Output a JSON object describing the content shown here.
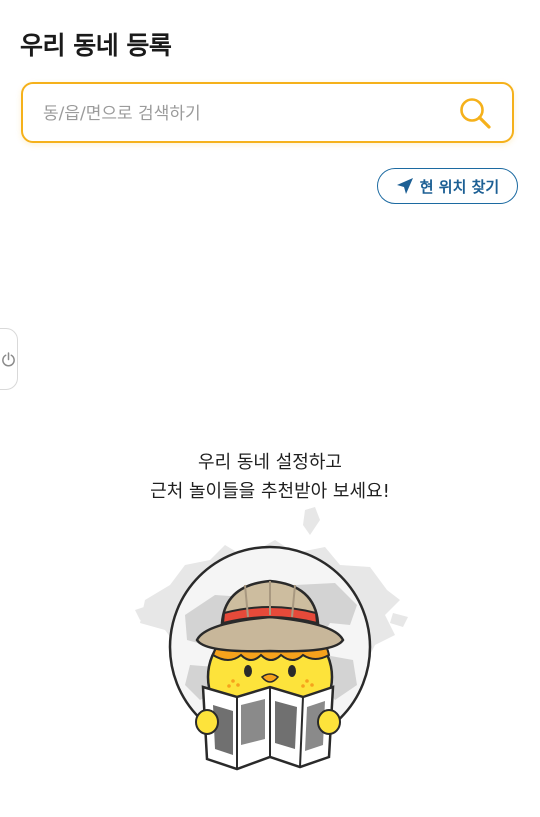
{
  "page": {
    "title": "우리 동네 등록"
  },
  "search": {
    "placeholder": "동/읍/면으로 검색하기",
    "value": ""
  },
  "locate_button": {
    "label": "현 위치 찾기"
  },
  "empty_state": {
    "line1": "우리 동네 설정하고",
    "line2": "근처 놀이들을 추천받아 보세요!"
  },
  "colors": {
    "accent": "#f5b11b",
    "locate": "#1c6aa1"
  },
  "icons": {
    "search": "search-icon",
    "locate": "navigation-arrow-icon",
    "side_tab": "power-icon"
  }
}
